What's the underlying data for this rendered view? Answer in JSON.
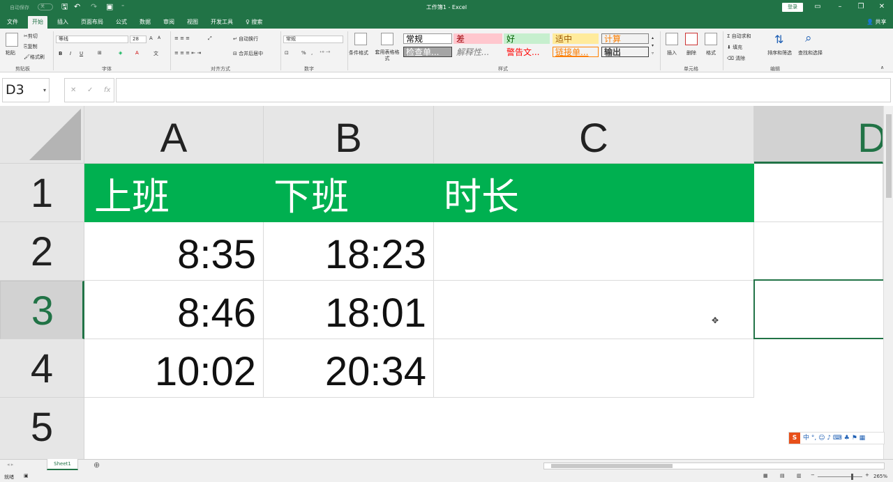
{
  "titlebar": {
    "autosave": "自动保存",
    "autosave_state": "关",
    "title": "工作簿1  -  Excel",
    "login": "登录",
    "icons": [
      "save-icon",
      "undo-icon",
      "redo-icon",
      "form-icon",
      "customize-icon"
    ],
    "window_icons": [
      "ribbon-display-icon",
      "minimize-icon",
      "restore-icon",
      "close-icon"
    ]
  },
  "tabs": {
    "items": [
      "文件",
      "开始",
      "插入",
      "页面布局",
      "公式",
      "数据",
      "审阅",
      "视图",
      "开发工具"
    ],
    "active": "开始",
    "search": "搜索",
    "share": "共享"
  },
  "ribbon": {
    "clipboard": {
      "paste": "粘贴",
      "cut": "剪切",
      "copy": "复制",
      "format_painter": "格式刷",
      "label": "剪贴板"
    },
    "font": {
      "name": "等线",
      "size": "28",
      "bold": "B",
      "italic": "I",
      "underline": "U",
      "grow": "A",
      "shrink": "A",
      "label": "字体"
    },
    "align": {
      "wrap": "自动换行",
      "merge": "合并后居中",
      "label": "对齐方式"
    },
    "number": {
      "format": "常规",
      "percent": "%",
      "comma": ",",
      "label": "数字"
    },
    "styles": {
      "conditional": "条件格式",
      "table": "套用表格格式",
      "label": "样式",
      "cells": [
        {
          "text": "常规",
          "bg": "#ffffff",
          "color": "#000000",
          "border": "#999999"
        },
        {
          "text": "差",
          "bg": "#ffc7ce",
          "color": "#9c0006",
          "border": "#ffc7ce"
        },
        {
          "text": "好",
          "bg": "#c6efce",
          "color": "#006100",
          "border": "#c6efce"
        },
        {
          "text": "适中",
          "bg": "#ffeb9c",
          "color": "#9c5700",
          "border": "#ffeb9c"
        },
        {
          "text": "计算",
          "bg": "#f2f2f2",
          "color": "#fa7d00",
          "border": "#7f7f7f"
        },
        {
          "text": "检查单...",
          "bg": "#a5a5a5",
          "color": "#ffffff",
          "border": "#3f3f3f"
        },
        {
          "text": "解释性...",
          "bg": "#f3f3f3",
          "color": "#7f7f7f",
          "border": "#f3f3f3"
        },
        {
          "text": "警告文...",
          "bg": "#f3f3f3",
          "color": "#ff0000",
          "border": "#f3f3f3"
        },
        {
          "text": "链接单...",
          "bg": "#f3f3f3",
          "color": "#fa7d00",
          "border": "#ff8001"
        },
        {
          "text": "输出",
          "bg": "#f2f2f2",
          "color": "#3f3f3f",
          "border": "#3f3f3f"
        }
      ]
    },
    "cells": {
      "insert": "插入",
      "delete": "删除",
      "format": "格式",
      "label": "单元格"
    },
    "editing": {
      "autosum": "自动求和",
      "fill": "填充",
      "clear": "清除",
      "sort": "排序和筛选",
      "find": "查找和选择",
      "label": "编辑"
    }
  },
  "formula_bar": {
    "name_box": "D3",
    "cancel": "✕",
    "enter": "✓",
    "fx": "fx",
    "value": ""
  },
  "sheet": {
    "columns": [
      {
        "label": "A"
      },
      {
        "label": "B"
      },
      {
        "label": "C"
      },
      {
        "label": "D"
      }
    ],
    "selected_column": "D",
    "rows": [
      "1",
      "2",
      "3",
      "4",
      "5"
    ],
    "selected_row": "3",
    "header_color": "#00b050",
    "cells": {
      "A1": "上班",
      "B1": "下班",
      "C1": "时长",
      "A2": "8:35",
      "B2": "18:23",
      "A3": "8:46",
      "B3": "18:01",
      "A4": "10:02",
      "B4": "20:34"
    }
  },
  "sheet_tabs": {
    "items": [
      "Sheet1"
    ],
    "add": "⊕"
  },
  "ime": {
    "logo": "S",
    "text": "中 °, ☺ ♪ ⌨ ♣ ⚑ ▦"
  },
  "status": {
    "ready": "就绪",
    "zoom": "265%"
  }
}
